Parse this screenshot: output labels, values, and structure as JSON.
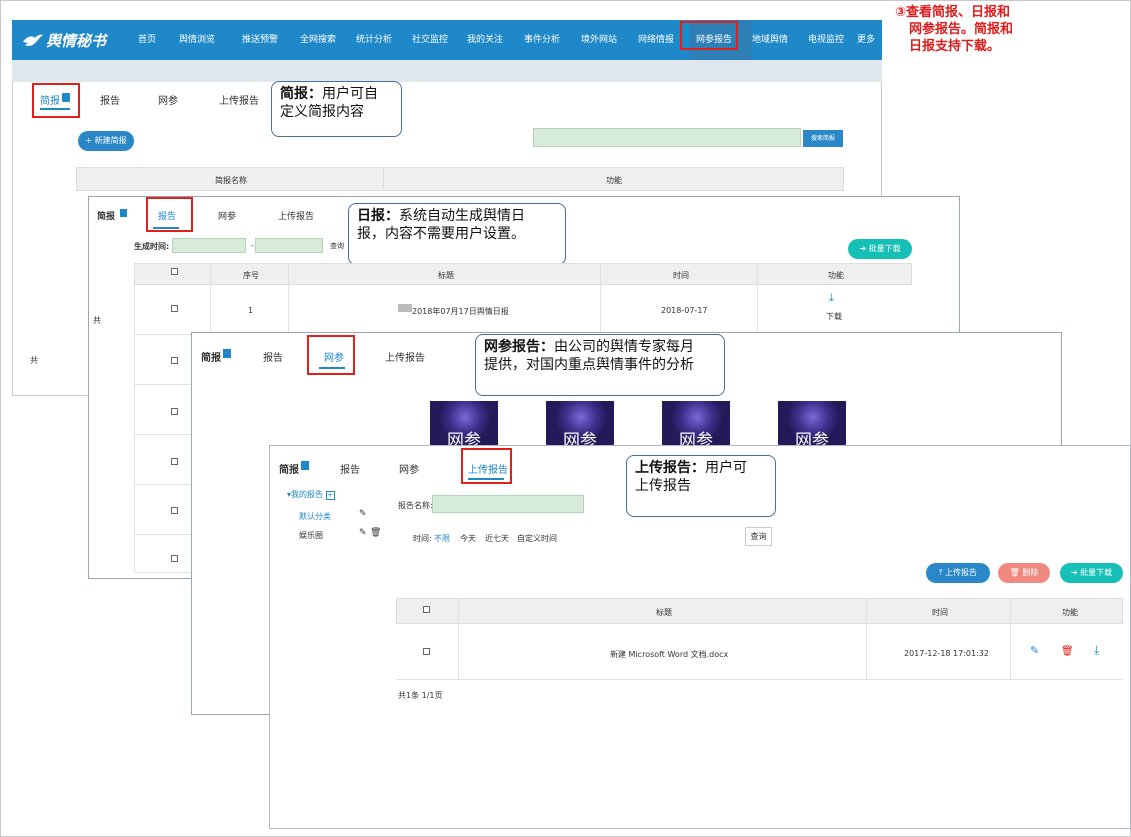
{
  "annotation": {
    "lines": [
      "③查看简报、日报和",
      "网参报告。简报和",
      "日报支持下载。"
    ]
  },
  "navbar": {
    "logo": "舆情秘书",
    "items": [
      "首页",
      "舆情浏览",
      "推送预警",
      "全网搜索",
      "统计分析",
      "社交监控",
      "我的关注",
      "事件分析",
      "境外网站",
      "网络情报",
      "网参报告",
      "地域舆情",
      "电视监控",
      "更多"
    ]
  },
  "tabs": {
    "brief": "简报",
    "daily": "报告",
    "wangcan": "网参",
    "upload": "上传报告"
  },
  "screen1": {
    "new_button": "+ 新建简报",
    "search_button": "搜索简报",
    "columns": [
      "简报名称",
      "功能"
    ],
    "callout_bold": "简报：",
    "callout_text": [
      "用户可自",
      "定义简报内容"
    ],
    "footer_partial": "共"
  },
  "screen2": {
    "date_label": "生成时间:",
    "date_sep": "-",
    "query_button": "查询",
    "batch_button": "批量下载",
    "columns": [
      "☐",
      "序号",
      "标题",
      "时间",
      "功能"
    ],
    "row": {
      "index": "1",
      "title": "2018年07月17日舆情日报",
      "time": "2018-07-17",
      "action": "下载"
    },
    "callout_bold": "日报：",
    "callout_text": [
      "系统自动生成舆情日",
      "报，内容不需要用户设置。"
    ],
    "footer_partial": "共"
  },
  "screen3": {
    "thumb_text": "网参",
    "callout_bold": "网参报告：",
    "callout_text": [
      "由公司的舆情专家每月",
      "提供，对国内重点舆情事件的分析"
    ]
  },
  "screen4": {
    "tree_root": "▾我的报告",
    "tree_items": [
      "默认分类",
      "娱乐圈"
    ],
    "name_label": "报告名称:",
    "time_label": "时间:",
    "time_options": [
      "不限",
      "今天",
      "近七天",
      "自定义时间"
    ],
    "query_button": "查询",
    "upload_button": "上传报告",
    "delete_button": "删除",
    "batch_button": "批量下载",
    "columns": [
      "☐",
      "标题",
      "时间",
      "功能"
    ],
    "row": {
      "title": "新建 Microsoft Word 文档.docx",
      "time": "2017-12-18 17:01:32"
    },
    "footer": "共1条 1/1页",
    "callout_bold": "上传报告：",
    "callout_text": [
      "用户可",
      "上传报告"
    ]
  },
  "colors": {
    "nav_blue": "#1f88c8",
    "highlight_red": "#e0201b",
    "annotation_red": "#e01b1b",
    "teal": "#17c0b6",
    "upload_blue": "#2a88c9",
    "delete_red": "#f08a80"
  }
}
